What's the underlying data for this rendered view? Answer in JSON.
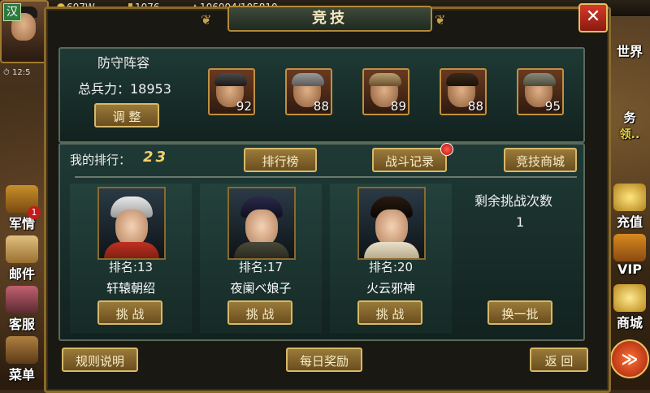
{
  "hud": {
    "nation": "汉",
    "coins": "607W",
    "energy": "1076",
    "troops": "106004/105810",
    "time": "12:5"
  },
  "left_menu": [
    {
      "label": "军情",
      "badge": "1"
    },
    {
      "label": "邮件"
    },
    {
      "label": "客服"
    },
    {
      "label": "菜单"
    }
  ],
  "right_menu": {
    "world": "世界",
    "task": "务",
    "task_sub": "领..",
    "recharge": "充值",
    "vip": "VIP",
    "shop": "商城"
  },
  "window": {
    "title": "竞技",
    "close": "✕"
  },
  "defense": {
    "title": "防守阵容",
    "troops_label": "总兵力：18953",
    "adjust_button": "调 整",
    "heroes": [
      {
        "level": "92"
      },
      {
        "level": "88"
      },
      {
        "level": "89"
      },
      {
        "level": "88"
      },
      {
        "level": "95"
      }
    ]
  },
  "ranking": {
    "label": "我的排行：",
    "value": "23",
    "leaderboard_button": "排行榜",
    "battle_log_button": "战斗记录",
    "shop_button": "竞技商城"
  },
  "opponents": [
    {
      "rank": "排名:13",
      "name": "轩辕朝绍",
      "button": "挑 战"
    },
    {
      "rank": "排名:17",
      "name": "夜阑ベ娘子",
      "button": "挑 战"
    },
    {
      "rank": "排名:20",
      "name": "火云邪神",
      "button": "挑 战"
    }
  ],
  "challenges": {
    "label": "剩余挑战次数",
    "value": "1",
    "refresh_button": "换一批"
  },
  "footer": {
    "rules_button": "规则说明",
    "daily_button": "每日奖励",
    "back_button": "返 回"
  },
  "colors": {
    "panel": "#1f3a36",
    "gold_border": "#d8b868",
    "rank_value": "#f2d068",
    "close": "#d63a2a"
  }
}
